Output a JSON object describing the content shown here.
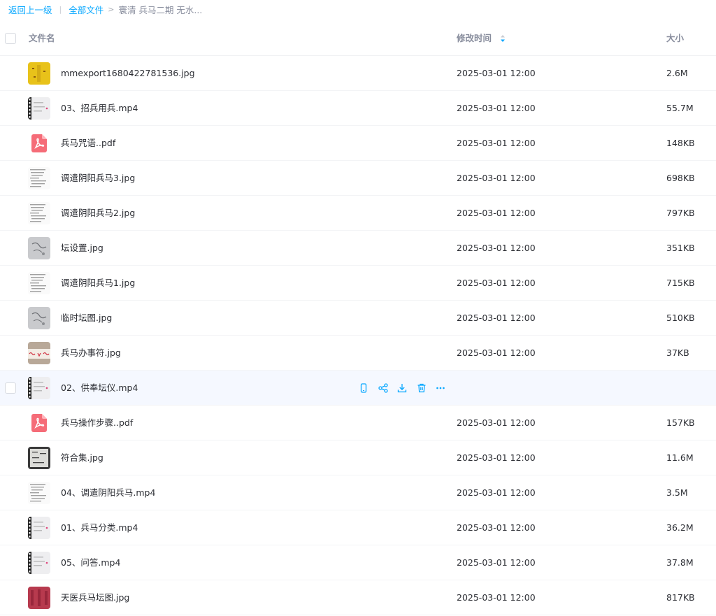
{
  "breadcrumb": {
    "back": "返回上一级",
    "all_files": "全部文件",
    "current": "寰清 兵马二期 无水..."
  },
  "columns": {
    "name": "文件名",
    "modified": "修改时间",
    "size": "大小"
  },
  "files": [
    {
      "name": "mmexport1680422781536.jpg",
      "time": "2025-03-01 12:00",
      "size": "2.6M",
      "thumb": "yellow-image"
    },
    {
      "name": "03、招兵用兵.mp4",
      "time": "2025-03-01 12:00",
      "size": "55.7M",
      "thumb": "video"
    },
    {
      "name": "兵马咒语..pdf",
      "time": "2025-03-01 12:00",
      "size": "148KB",
      "thumb": "pdf-icon"
    },
    {
      "name": "调遣阴阳兵马3.jpg",
      "time": "2025-03-01 12:00",
      "size": "698KB",
      "thumb": "doc-image"
    },
    {
      "name": "调遣阴阳兵马2.jpg",
      "time": "2025-03-01 12:00",
      "size": "797KB",
      "thumb": "doc-image"
    },
    {
      "name": "坛设置.jpg",
      "time": "2025-03-01 12:00",
      "size": "351KB",
      "thumb": "gray-image"
    },
    {
      "name": "调遣阴阳兵马1.jpg",
      "time": "2025-03-01 12:00",
      "size": "715KB",
      "thumb": "doc-image"
    },
    {
      "name": "临时坛图.jpg",
      "time": "2025-03-01 12:00",
      "size": "510KB",
      "thumb": "gray-image"
    },
    {
      "name": "兵马办事符.jpg",
      "time": "2025-03-01 12:00",
      "size": "37KB",
      "thumb": "talisman-image"
    },
    {
      "name": "02、供奉坛仪.mp4",
      "time": "",
      "size": "",
      "thumb": "video",
      "hovered": true
    },
    {
      "name": "兵马操作步骤..pdf",
      "time": "2025-03-01 12:00",
      "size": "157KB",
      "thumb": "pdf-icon"
    },
    {
      "name": "符合集.jpg",
      "time": "2025-03-01 12:00",
      "size": "11.6M",
      "thumb": "dark-image"
    },
    {
      "name": "04、调遣阴阳兵马.mp4",
      "time": "2025-03-01 12:00",
      "size": "3.5M",
      "thumb": "doc-image"
    },
    {
      "name": "01、兵马分类.mp4",
      "time": "2025-03-01 12:00",
      "size": "36.2M",
      "thumb": "video"
    },
    {
      "name": "05、问答.mp4",
      "time": "2025-03-01 12:00",
      "size": "37.8M",
      "thumb": "video"
    },
    {
      "name": "天医兵马坛图.jpg",
      "time": "2025-03-01 12:00",
      "size": "817KB",
      "thumb": "red-image"
    }
  ],
  "row_actions": [
    "phone-icon",
    "share-icon",
    "download-icon",
    "delete-icon",
    "more-icon"
  ],
  "colors": {
    "accent": "#06a7ff",
    "pdf_red": "#f56c78",
    "hover_row": "#f5f8ff"
  }
}
